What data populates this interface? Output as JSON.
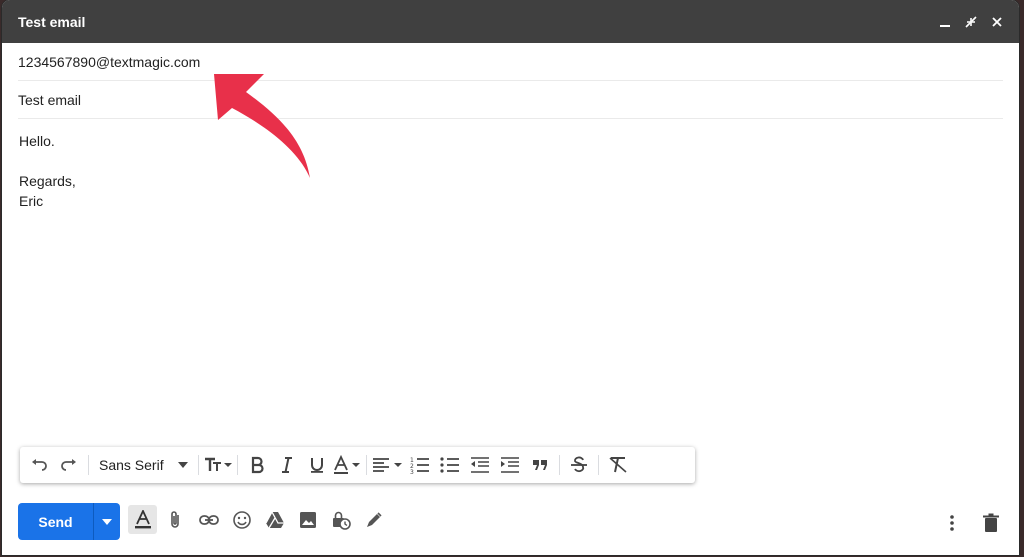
{
  "window": {
    "title": "Test email"
  },
  "window_controls": [
    "minimize-icon",
    "exit-fullscreen-icon",
    "close-icon"
  ],
  "compose": {
    "to": "1234567890@textmagic.com",
    "subject": "Test email",
    "body": "Hello.\n\nRegards,\nEric"
  },
  "toolbar": {
    "font": "Sans Serif",
    "tools": [
      "undo",
      "redo",
      "font",
      "text-size",
      "bold",
      "italic",
      "underline",
      "text-color",
      "align",
      "numbered-list",
      "bulleted-list",
      "indent-less",
      "indent-more",
      "quote",
      "strikethrough",
      "remove-formatting"
    ]
  },
  "bottom": {
    "send_label": "Send",
    "icons": [
      "formatting-options-icon",
      "attach-icon",
      "link-icon",
      "emoji-icon",
      "drive-icon",
      "photo-icon",
      "confidential-icon",
      "signature-icon",
      "more-options-icon",
      "trash-icon"
    ]
  },
  "annotation": {
    "arrow_color": "#e8304a"
  },
  "colors": {
    "titlebar": "#404040",
    "send": "#1a73e8"
  }
}
